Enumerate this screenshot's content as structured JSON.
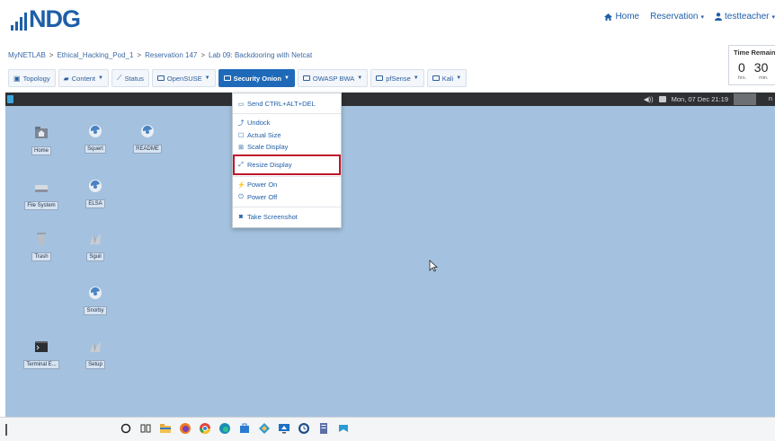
{
  "brand": {
    "logo_text": "NDG",
    "color": "#1f5fa8"
  },
  "topnav": {
    "home": "Home",
    "reservation": "Reservation",
    "user": "testteacher"
  },
  "breadcrumb": [
    "MyNETLAB",
    "Ethical_Hacking_Pod_1",
    "Reservation 147",
    "Lab 09: Backdooring with Netcat"
  ],
  "time_remaining": {
    "title": "Time Remaining",
    "hours": "0",
    "minutes": "30",
    "hours_unit": "hrs.",
    "minutes_unit": "min."
  },
  "toolbar": {
    "topology": "Topology",
    "content": "Content",
    "status": "Status",
    "opensuse": "OpenSUSE",
    "security_onion": "Security Onion",
    "owasp": "OWASP BWA",
    "pfsense": "pfSense",
    "kali": "Kali",
    "active_color": "#1f6ab8"
  },
  "menu": {
    "send_ctrl_alt_del": "Send CTRL+ALT+DEL",
    "undock": "Undock",
    "actual_size": "Actual Size",
    "scale_display": "Scale Display",
    "resize_display": "Resize Display",
    "power_on": "Power On",
    "power_off": "Power Off",
    "take_screenshot": "Take Screenshot",
    "highlight_color": "#c0162a"
  },
  "vm": {
    "clock": "Mon, 07 Dec 21:19",
    "corner_text": "n",
    "background": "#a4c2df",
    "icons": {
      "home": "Home",
      "squert": "Squert",
      "readme": "README",
      "file_system": "File System",
      "elsa": "ELSA",
      "trash": "Trash",
      "sguil": "Sguil",
      "snorby": "Snorby",
      "terminal": "Terminal E...",
      "setup": "Setup"
    }
  }
}
